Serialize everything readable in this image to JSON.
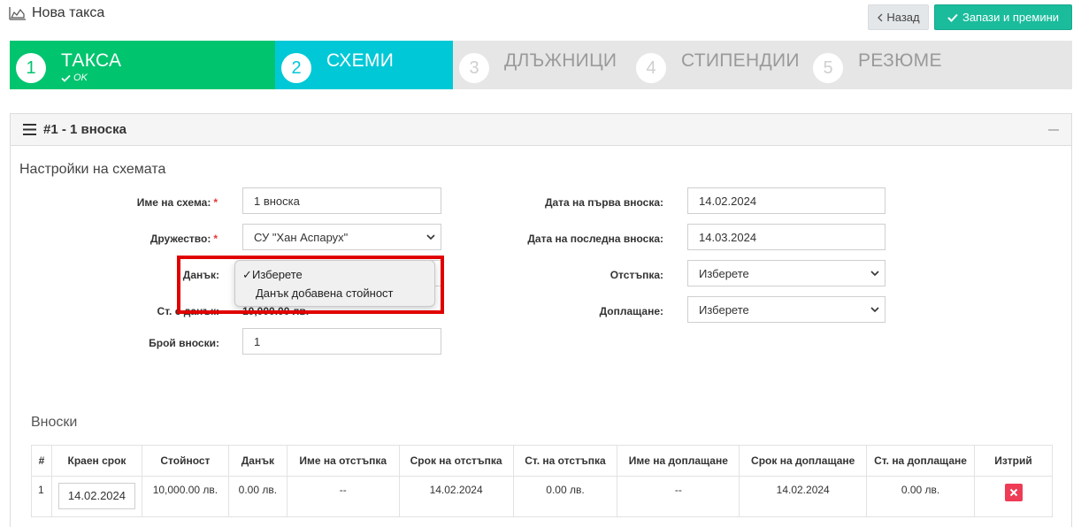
{
  "header": {
    "title": "Нова такса",
    "back_label": "Назад",
    "save_label": "Запази и премини"
  },
  "wizard": {
    "steps": [
      {
        "num": "1",
        "label": "ТАКСА",
        "status": "OK"
      },
      {
        "num": "2",
        "label": "СХЕМИ"
      },
      {
        "num": "3",
        "label": "ДЛЪЖНИЦИ"
      },
      {
        "num": "4",
        "label": "СТИПЕНДИИ"
      },
      {
        "num": "5",
        "label": "РЕЗЮМЕ"
      }
    ]
  },
  "panel": {
    "title": "#1 - 1 вноска",
    "section_title": "Настройки на схемата",
    "fields": {
      "scheme_name": {
        "label": "Име на схема:",
        "value": "1 вноска"
      },
      "company": {
        "label": "Дружество:",
        "value": "СУ \"Хан Аспарух\""
      },
      "tax": {
        "label": "Данък:"
      },
      "amount": {
        "label": "Ст. с данък:",
        "value": "10,000.00 лв."
      },
      "count": {
        "label": "Брой вноски:",
        "value": "1"
      },
      "first_date": {
        "label": "Дата на първа вноска:",
        "value": "14.02.2024"
      },
      "last_date": {
        "label": "Дата на последна вноска:",
        "value": "14.03.2024"
      },
      "discount": {
        "label": "Отстъпка:",
        "value": "Изберете"
      },
      "surcharge": {
        "label": "Доплащане:",
        "value": "Изберете"
      }
    },
    "tax_dropdown": {
      "options": [
        "Изберете",
        "Данък добавена стойност"
      ],
      "selected_mark": "✓"
    }
  },
  "installments": {
    "title": "Вноски",
    "columns": [
      "#",
      "Краен срок",
      "Стойност",
      "Данък",
      "Име на отстъпка",
      "Срок на отстъпка",
      "Ст. на отстъпка",
      "Име на доплащане",
      "Срок на доплащане",
      "Ст. на доплащане",
      "Изтрий"
    ],
    "rows": [
      {
        "num": "1",
        "deadline": "14.02.2024",
        "value": "10,000.00 лв.",
        "tax": "0.00 лв.",
        "discount_name": "--",
        "discount_deadline": "14.02.2024",
        "discount_value": "0.00 лв.",
        "surcharge_name": "--",
        "surcharge_deadline": "14.02.2024",
        "surcharge_value": "0.00 лв."
      }
    ]
  },
  "colors": {
    "done": "#00c46e",
    "active": "#00c8d7",
    "save": "#1abc9c",
    "delete": "#ee3b56",
    "highlight": "#e00000"
  }
}
